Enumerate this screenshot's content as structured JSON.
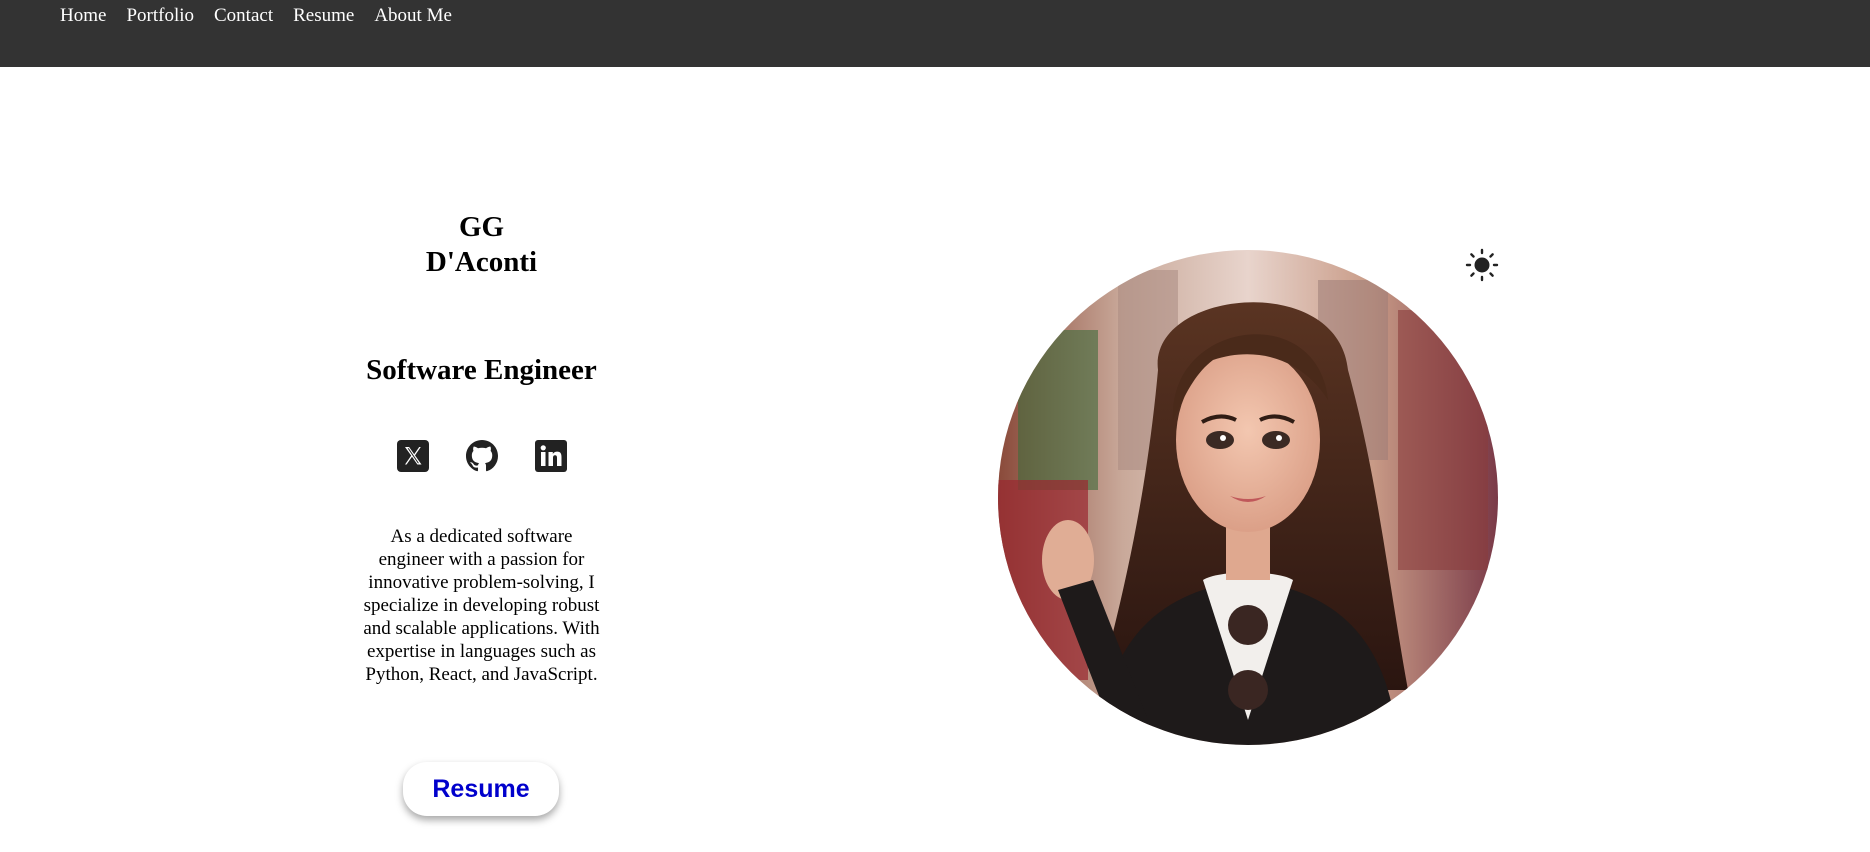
{
  "nav": {
    "items": [
      {
        "label": "Home"
      },
      {
        "label": "Portfolio"
      },
      {
        "label": "Contact"
      },
      {
        "label": "Resume"
      },
      {
        "label": "About Me"
      }
    ]
  },
  "profile": {
    "name_line1": "GG",
    "name_line2": "D'Aconti",
    "role": "Software Engineer",
    "bio": "As a dedicated software engineer with a passion for innovative problem-solving, I specialize in developing robust and scalable applications. With expertise in languages such as Python, React, and JavaScript.",
    "resume_button_label": "Resume"
  },
  "socials": [
    {
      "icon": "x-twitter-icon"
    },
    {
      "icon": "github-icon"
    },
    {
      "icon": "linkedin-icon"
    }
  ],
  "theme_toggle": {
    "icon": "sun-icon"
  },
  "avatar": {
    "icon": "cartoon-woman-portrait"
  },
  "colors": {
    "navbar_bg": "#333333",
    "nav_text": "#ffffff",
    "resume_text": "#0000cc",
    "icon_dark": "#222222"
  }
}
